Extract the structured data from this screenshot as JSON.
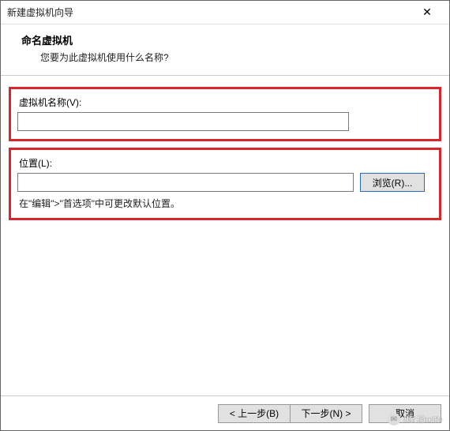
{
  "titlebar": {
    "title": "新建虚拟机向导"
  },
  "header": {
    "title": "命名虚拟机",
    "subtitle": "您要为此虚拟机使用什么名称?"
  },
  "fields": {
    "name": {
      "label": "虚拟机名称(V):",
      "value": ""
    },
    "location": {
      "label": "位置(L):",
      "value": "",
      "browse": "浏览(R)..."
    },
    "hint": "在\"编辑\">\"首选项\"中可更改默认位置。"
  },
  "footer": {
    "back": "< 上一步(B)",
    "next": "下一步(N) >",
    "cancel": "取消"
  },
  "watermark": {
    "text": "li取消tolife"
  }
}
